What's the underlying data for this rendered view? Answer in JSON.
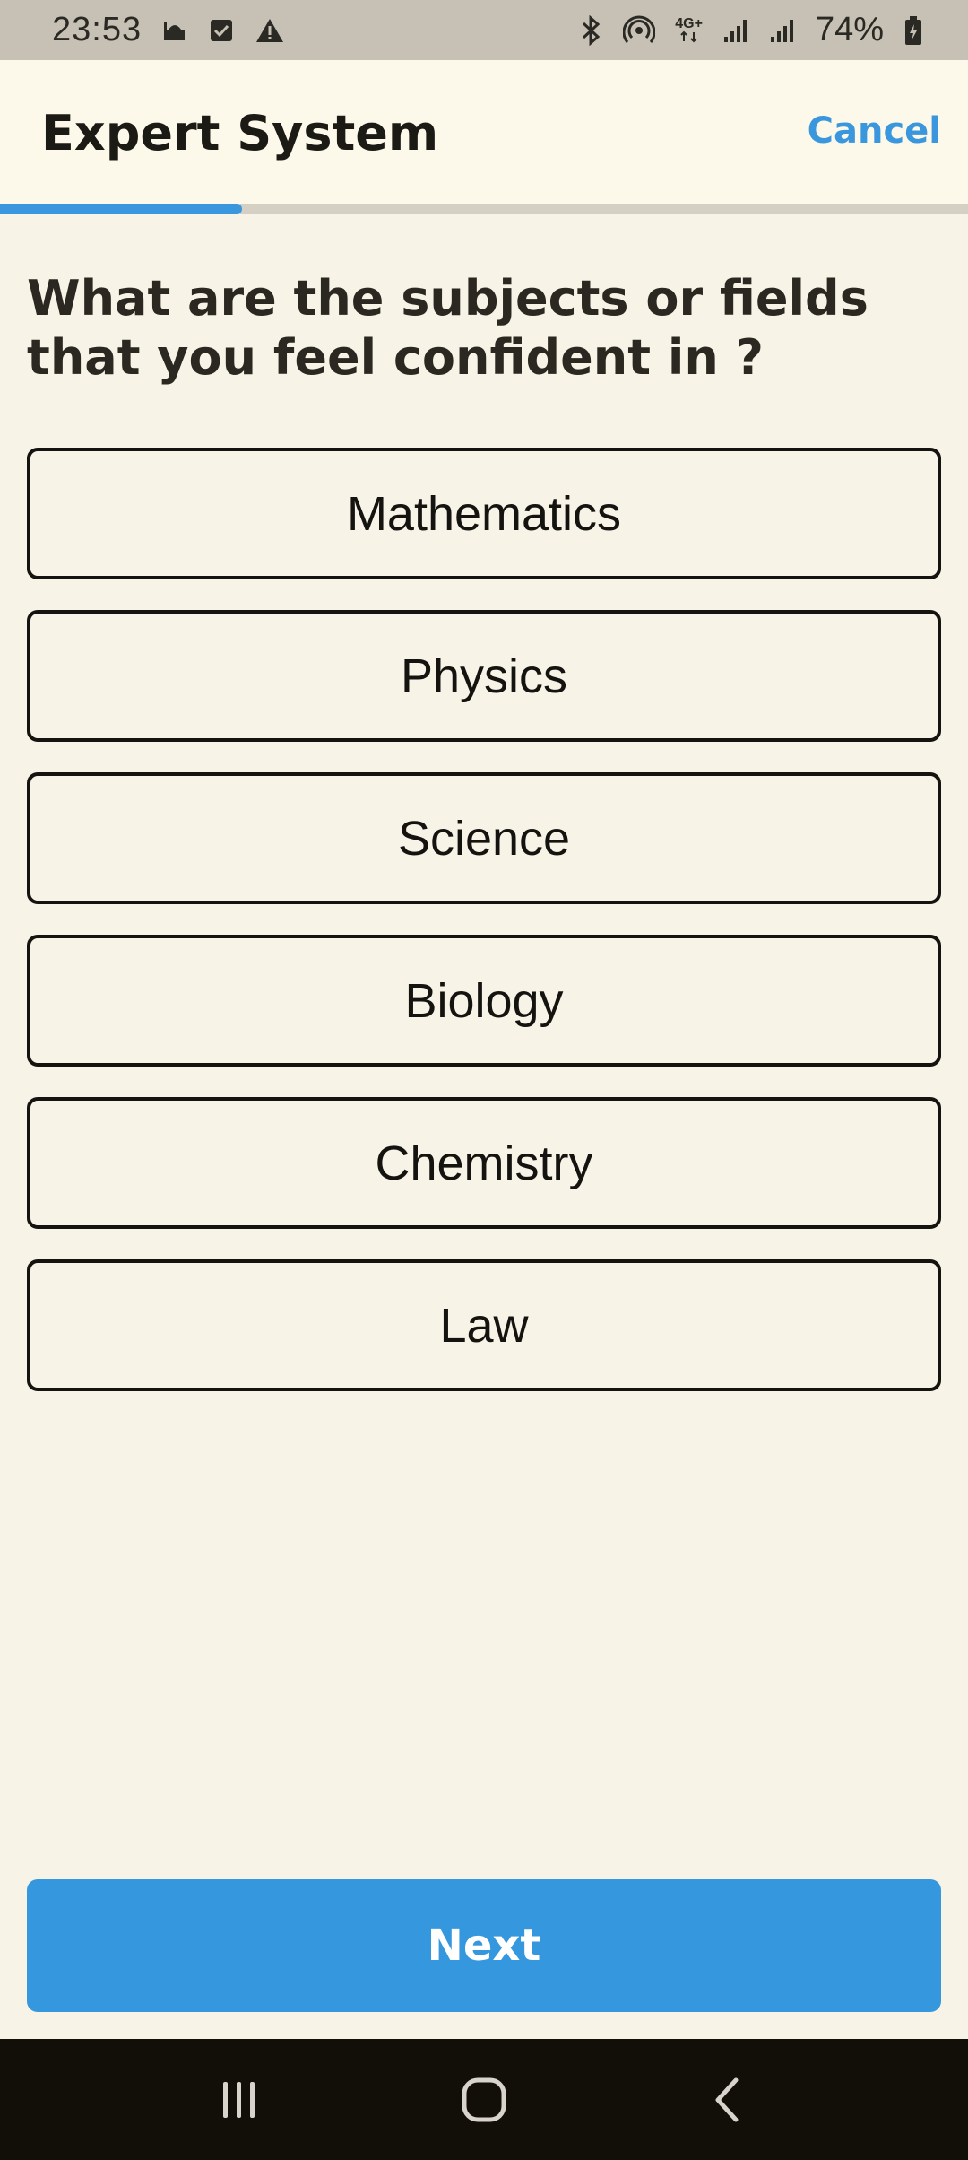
{
  "status_bar": {
    "time": "23:53",
    "battery": "74%",
    "network": "4G+",
    "left_icons": [
      "mosque-icon",
      "checkbox-icon",
      "warning-icon"
    ],
    "right_icons": [
      "bluetooth-icon",
      "hotspot-icon",
      "network-4g-icon",
      "signal-icon",
      "signal-icon",
      "battery-icon"
    ]
  },
  "header": {
    "title": "Expert System",
    "cancel_label": "Cancel"
  },
  "progress": {
    "fraction": 0.25
  },
  "question": "What are the subjects or fields that you feel confident in ?",
  "options": [
    "Mathematics",
    "Physics",
    "Science",
    "Biology",
    "Chemistry",
    "Law"
  ],
  "next_label": "Next",
  "colors": {
    "accent": "#3598df",
    "background": "#f7f3e6",
    "header_bg": "#fdf9ea",
    "status_bar_bg": "#c6c1b4",
    "nav_bar_bg": "#120e08"
  },
  "nav_bar": {
    "buttons": [
      "recent-apps-icon",
      "home-icon",
      "back-icon"
    ]
  }
}
